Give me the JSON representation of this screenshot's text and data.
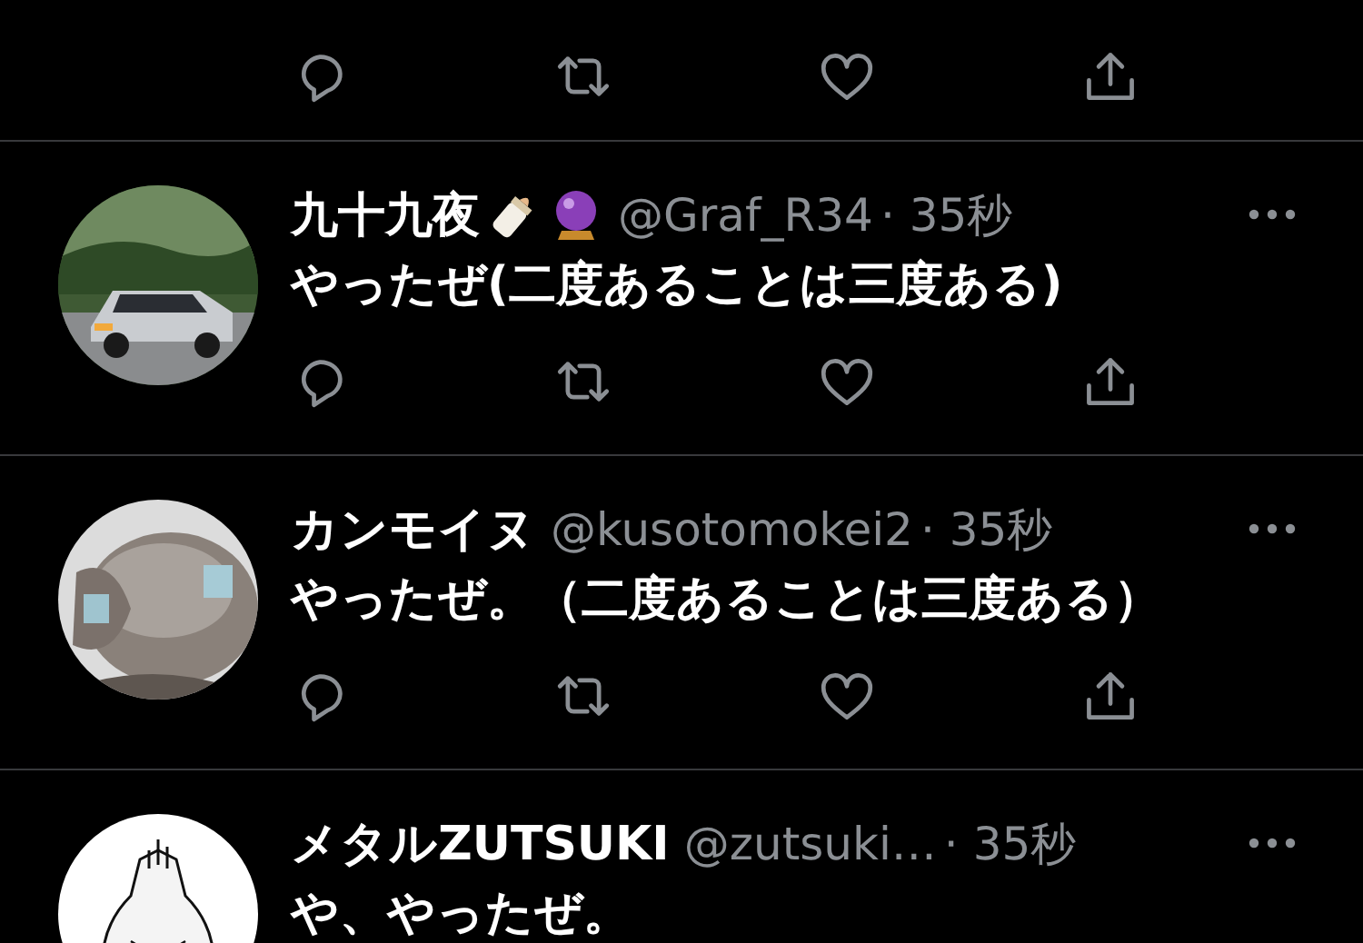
{
  "tweets": [
    {
      "name": "九十九夜",
      "handle": "@Graf_R34",
      "time": "· 35秒",
      "text": "やったぜ(二度あることは三度ある)"
    },
    {
      "name": "カンモイヌ",
      "handle": "@kusotomokei2",
      "time": "· 35秒",
      "text": "やったぜ。（二度あることは三度ある）"
    },
    {
      "name": "メタルZUTSUKI",
      "handle": "@zutsuki…",
      "time": "· 35秒",
      "text": "や、やったぜ。"
    }
  ]
}
